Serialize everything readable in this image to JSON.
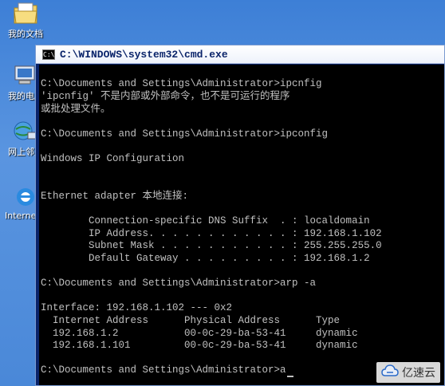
{
  "desktop": {
    "icons": [
      {
        "label": "我的文档",
        "icon": "documents-folder-icon"
      },
      {
        "label": "我的电脑",
        "icon": "my-computer-icon"
      },
      {
        "label": "网上邻居",
        "icon": "network-places-icon"
      },
      {
        "label": "Internet Explorer",
        "icon": "internet-explorer-icon"
      }
    ]
  },
  "window": {
    "title": "C:\\WINDOWS\\system32\\cmd.exe",
    "icon_text": "C:\\"
  },
  "console": {
    "lines": [
      "C:\\Documents and Settings\\Administrator>ipcnfig",
      "'ipcnfig' 不是内部或外部命令，也不是可运行的程序",
      "或批处理文件。",
      "",
      "C:\\Documents and Settings\\Administrator>ipconfig",
      "",
      "Windows IP Configuration",
      "",
      "",
      "Ethernet adapter 本地连接:",
      "",
      "        Connection-specific DNS Suffix  . : localdomain",
      "        IP Address. . . . . . . . . . . . : 192.168.1.102",
      "        Subnet Mask . . . . . . . . . . . : 255.255.255.0",
      "        Default Gateway . . . . . . . . . : 192.168.1.2",
      "",
      "C:\\Documents and Settings\\Administrator>arp -a",
      "",
      "Interface: 192.168.1.102 --- 0x2",
      "  Internet Address      Physical Address      Type",
      "  192.168.1.2           00-0c-29-ba-53-41     dynamic",
      "  192.168.1.101         00-0c-29-ba-53-41     dynamic",
      "",
      "C:\\Documents and Settings\\Administrator>a"
    ]
  },
  "watermark": {
    "text": "亿速云",
    "icon": "cloud-logo-icon"
  }
}
